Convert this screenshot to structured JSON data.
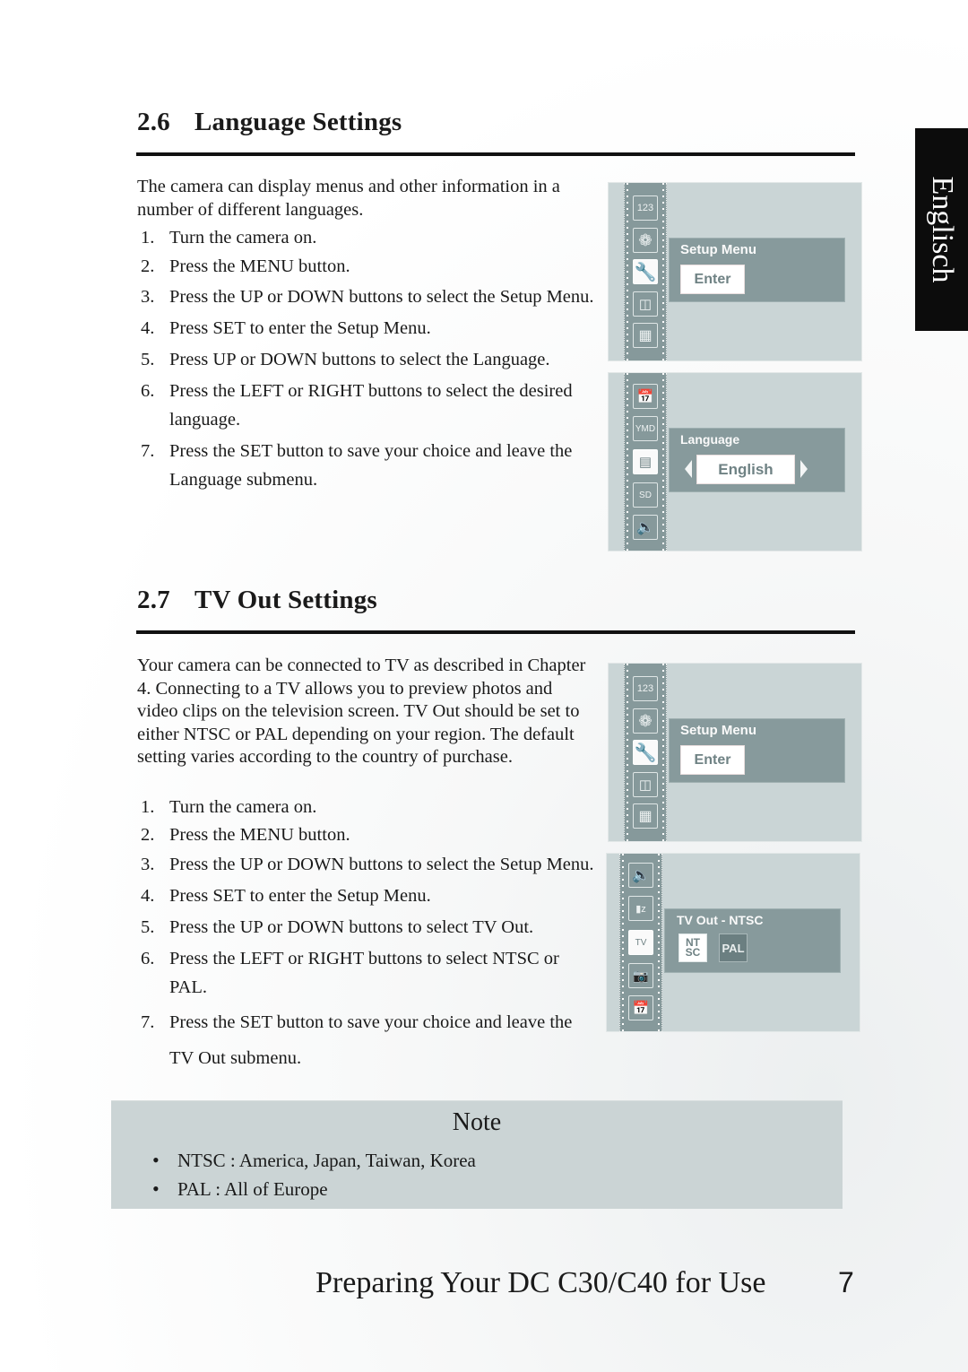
{
  "side_tab": {
    "label": "Englisch"
  },
  "section_language": {
    "number": "2.6",
    "title": "Language Settings",
    "intro": "The camera can display menus and other information in a number of different languages.",
    "steps": [
      {
        "n": "1.",
        "text": "Turn the camera on."
      },
      {
        "n": "2.",
        "text": "Press the MENU button."
      },
      {
        "n": "3.",
        "text": "Press the UP or DOWN buttons to select the Setup Menu."
      },
      {
        "n": "4.",
        "text": "Press SET to enter the Setup Menu."
      },
      {
        "n": "5.",
        "text": "Press UP or DOWN buttons to select the Language."
      },
      {
        "n": "6.",
        "text": "Press the LEFT or RIGHT buttons to select the desired language."
      },
      {
        "n": "7.",
        "text": "Press the SET button to save your choice and leave the Language submenu."
      }
    ]
  },
  "screen_setup_1": {
    "icons": [
      "123",
      "aperture",
      "wrench",
      "playback",
      "slideshow"
    ],
    "panel_title": "Setup Menu",
    "button": "Enter"
  },
  "screen_language": {
    "icons": [
      "date-time",
      "YMD",
      "language",
      "SD",
      "sound"
    ],
    "panel_title": "Language",
    "value": "English"
  },
  "section_tvout": {
    "number": "2.7",
    "title": "TV Out Settings",
    "intro": "Your camera can be connected to TV as described in Chapter 4. Connecting to a TV allows you to preview photos and video clips on the television screen. TV Out should be set to either NTSC or PAL depending on your region. The default setting varies according to the country of purchase.",
    "steps": [
      {
        "n": "1.",
        "text": "Turn the camera on."
      },
      {
        "n": "2.",
        "text": "Press the MENU button."
      },
      {
        "n": "3.",
        "text": "Press the UP or DOWN buttons to select the Setup Menu."
      },
      {
        "n": "4.",
        "text": "Press SET to enter the Setup Menu."
      },
      {
        "n": "5.",
        "text": "Press the UP or DOWN buttons to select TV Out."
      },
      {
        "n": "6.",
        "text": "Press the LEFT or RIGHT buttons to select NTSC or PAL."
      },
      {
        "n": "7.",
        "text": "Press the SET button to save your choice and leave the TV Out submenu."
      }
    ]
  },
  "screen_setup_2": {
    "panel_title": "Setup Menu",
    "button": "Enter"
  },
  "screen_tvout": {
    "icons": [
      "sound",
      "power-save",
      "tv",
      "camera-reset",
      "date-time"
    ],
    "panel_title": "TV Out - NTSC",
    "option_ntsc_1": "NT",
    "option_ntsc_2": "SC",
    "option_pal": "PAL"
  },
  "note": {
    "title": "Note",
    "items": [
      "NTSC : America, Japan, Taiwan, Korea",
      "PAL : All of Europe"
    ]
  },
  "footer": {
    "title": "Preparing Your DC C30/C40 for Use",
    "page_number": "7"
  },
  "colors": {
    "screen_bg": "#cad5d6",
    "panel_bg": "#879a9c",
    "note_bg": "#cbd4d5",
    "tab_bg": "#0c0c0c"
  }
}
